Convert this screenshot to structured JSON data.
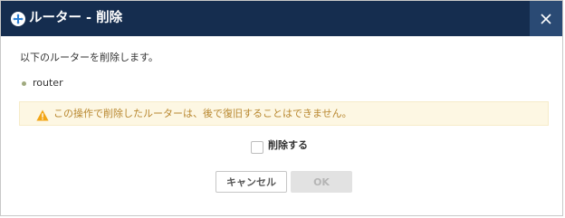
{
  "dialog": {
    "title": "ルーター - 削除",
    "title_icon": "plus-circle-icon",
    "close_icon": "close-icon",
    "message": "以下のルーターを削除します。",
    "items": [
      "router"
    ],
    "warning": {
      "icon": "warning-icon",
      "text": "この操作で削除したルーターは、後で復旧することはできません。"
    },
    "confirm": {
      "label": "削除する",
      "checked": false
    },
    "buttons": {
      "cancel": "キャンセル",
      "ok": "OK",
      "ok_disabled": true
    }
  },
  "colors": {
    "titlebar": "#152d4f",
    "close_button": "#2a4a74",
    "warning_background": "#fdf7e3",
    "warning_text": "#b8872f",
    "warning_icon": "#f2a516",
    "bullet": "#a0aa7f"
  }
}
